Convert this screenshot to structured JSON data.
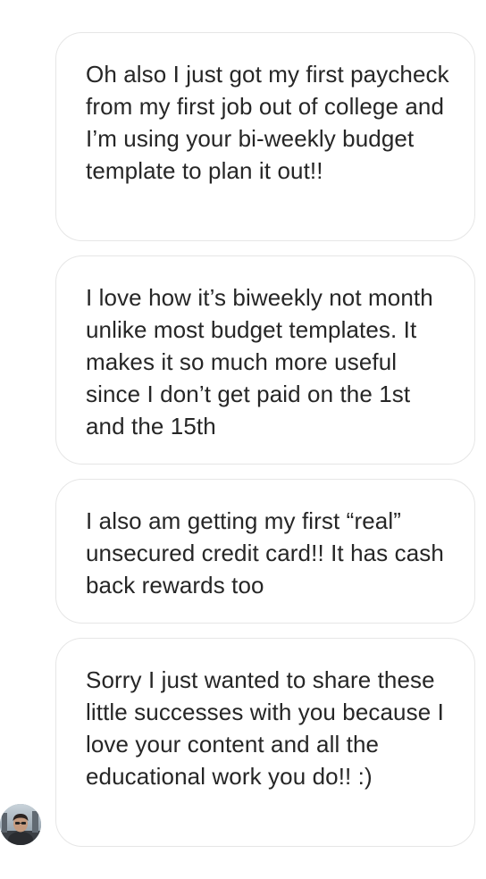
{
  "messages": [
    {
      "text": "Oh also I just got my first paycheck from my first job out of college and I’m using your bi-weekly budget template to plan it out!!"
    },
    {
      "text": "I love how it’s biweekly not month unlike most budget templates. It makes it so much more useful since I don’t get paid on the 1st and the 15th"
    },
    {
      "text": "I also am getting my first “real” unsecured credit card!! It has cash back rewards too"
    },
    {
      "text": "Sorry I just wanted to share these little successes with you because I love your content and all the educational work you do!! :)"
    }
  ],
  "sender": {
    "avatar_icon": "user-avatar-photo"
  },
  "colors": {
    "bubble_border": "#e6e6e6",
    "text": "#262626",
    "background": "#ffffff"
  }
}
